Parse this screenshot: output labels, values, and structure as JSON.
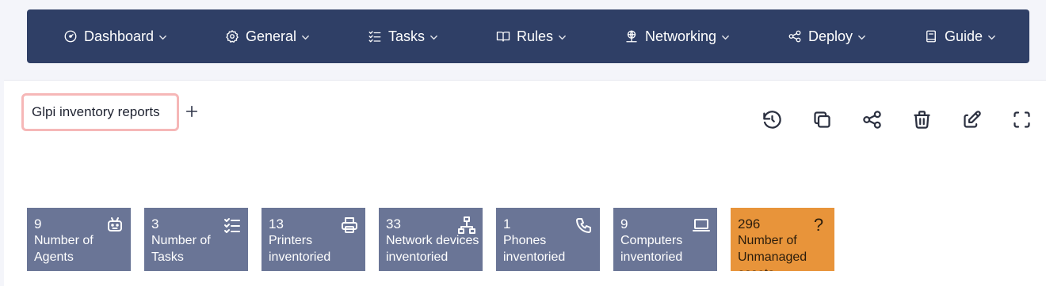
{
  "nav": {
    "items": [
      {
        "label": "Dashboard",
        "icon": "dashboard-gauge-icon"
      },
      {
        "label": "General",
        "icon": "gear-icon"
      },
      {
        "label": "Tasks",
        "icon": "checklist-icon"
      },
      {
        "label": "Rules",
        "icon": "book-icon"
      },
      {
        "label": "Networking",
        "icon": "network-globe-icon"
      },
      {
        "label": "Deploy",
        "icon": "share-icon"
      },
      {
        "label": "Guide",
        "icon": "notebook-icon"
      }
    ]
  },
  "dashboard": {
    "tab_label": "Glpi inventory reports",
    "add_label": "+"
  },
  "toolbar": {
    "items": [
      "history-icon",
      "copy-icon",
      "share-icon",
      "trash-icon",
      "edit-icon",
      "fullscreen-icon"
    ]
  },
  "cards": [
    {
      "value": "9",
      "label": "Number of Agents",
      "icon": "robot-icon",
      "color": "#6a7596"
    },
    {
      "value": "3",
      "label": "Number of Tasks",
      "icon": "checklist-icon",
      "color": "#6a7596"
    },
    {
      "value": "13",
      "label": "Printers inventoried",
      "icon": "printer-icon",
      "color": "#6a7596"
    },
    {
      "value": "33",
      "label": "Network devices inventoried",
      "icon": "network-icon",
      "color": "#6a7596"
    },
    {
      "value": "1",
      "label": "Phones inventoried",
      "icon": "phone-icon",
      "color": "#6a7596"
    },
    {
      "value": "9",
      "label": "Computers inventoried",
      "icon": "laptop-icon",
      "color": "#6a7596"
    },
    {
      "value": "296",
      "label": "Number of Unmanaged assets",
      "icon": "question-icon",
      "glyph": "?",
      "color": "#e8943a"
    }
  ],
  "colors": {
    "nav_bg": "#2f3f66",
    "card_bg": "#6a7596",
    "card_alert_bg": "#e8943a",
    "tab_border": "#f6b7b7"
  }
}
